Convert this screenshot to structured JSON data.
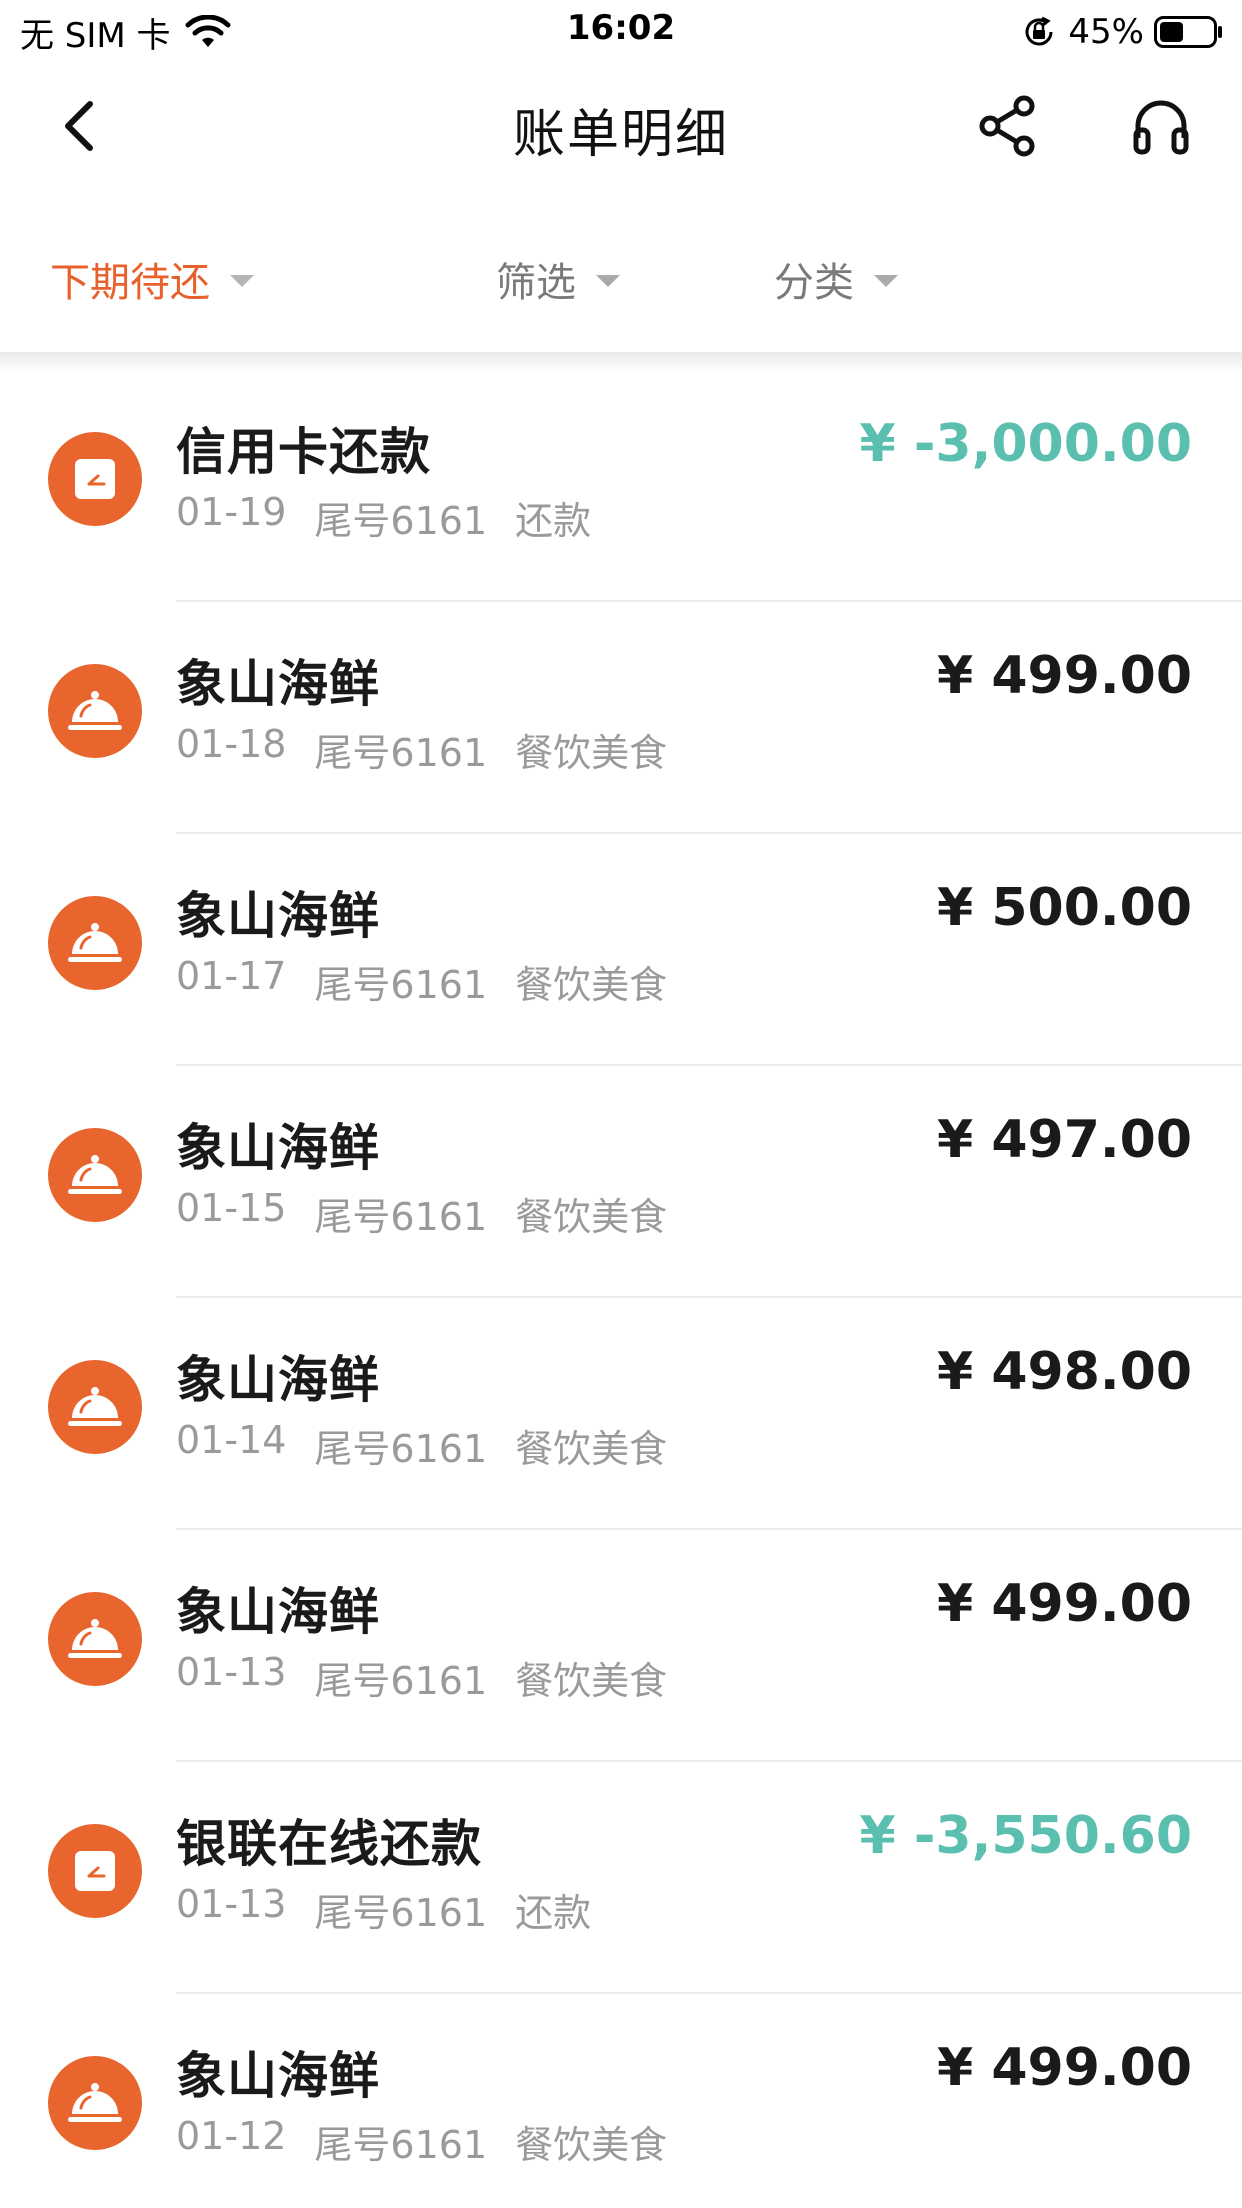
{
  "status_bar": {
    "carrier": "无 SIM 卡",
    "time": "16:02",
    "battery": "45%",
    "battery_level": 0.45
  },
  "nav": {
    "title": "账单明细"
  },
  "filters": [
    {
      "label": "下期待还",
      "active": true
    },
    {
      "label": "筛选",
      "active": false
    },
    {
      "label": "分类",
      "active": false
    }
  ],
  "colors": {
    "accent": "#e8612c",
    "repay_amount": "#5bbfb0",
    "icon_bg": "#e8662e"
  },
  "transactions": [
    {
      "name": "信用卡还款",
      "date": "01-19",
      "card": "尾号6161",
      "category": "还款",
      "amount": "¥ -3,000.00",
      "type": "repay",
      "icon": "repayment-icon"
    },
    {
      "name": "象山海鲜",
      "date": "01-18",
      "card": "尾号6161",
      "category": "餐饮美食",
      "amount": "¥ 499.00",
      "type": "spend",
      "icon": "dining-cloche-icon"
    },
    {
      "name": "象山海鲜",
      "date": "01-17",
      "card": "尾号6161",
      "category": "餐饮美食",
      "amount": "¥ 500.00",
      "type": "spend",
      "icon": "dining-cloche-icon"
    },
    {
      "name": "象山海鲜",
      "date": "01-15",
      "card": "尾号6161",
      "category": "餐饮美食",
      "amount": "¥ 497.00",
      "type": "spend",
      "icon": "dining-cloche-icon"
    },
    {
      "name": "象山海鲜",
      "date": "01-14",
      "card": "尾号6161",
      "category": "餐饮美食",
      "amount": "¥ 498.00",
      "type": "spend",
      "icon": "dining-cloche-icon"
    },
    {
      "name": "象山海鲜",
      "date": "01-13",
      "card": "尾号6161",
      "category": "餐饮美食",
      "amount": "¥ 499.00",
      "type": "spend",
      "icon": "dining-cloche-icon"
    },
    {
      "name": "银联在线还款",
      "date": "01-13",
      "card": "尾号6161",
      "category": "还款",
      "amount": "¥ -3,550.60",
      "type": "repay",
      "icon": "repayment-icon"
    },
    {
      "name": "象山海鲜",
      "date": "01-12",
      "card": "尾号6161",
      "category": "餐饮美食",
      "amount": "¥ 499.00",
      "type": "spend",
      "icon": "dining-cloche-icon"
    }
  ]
}
